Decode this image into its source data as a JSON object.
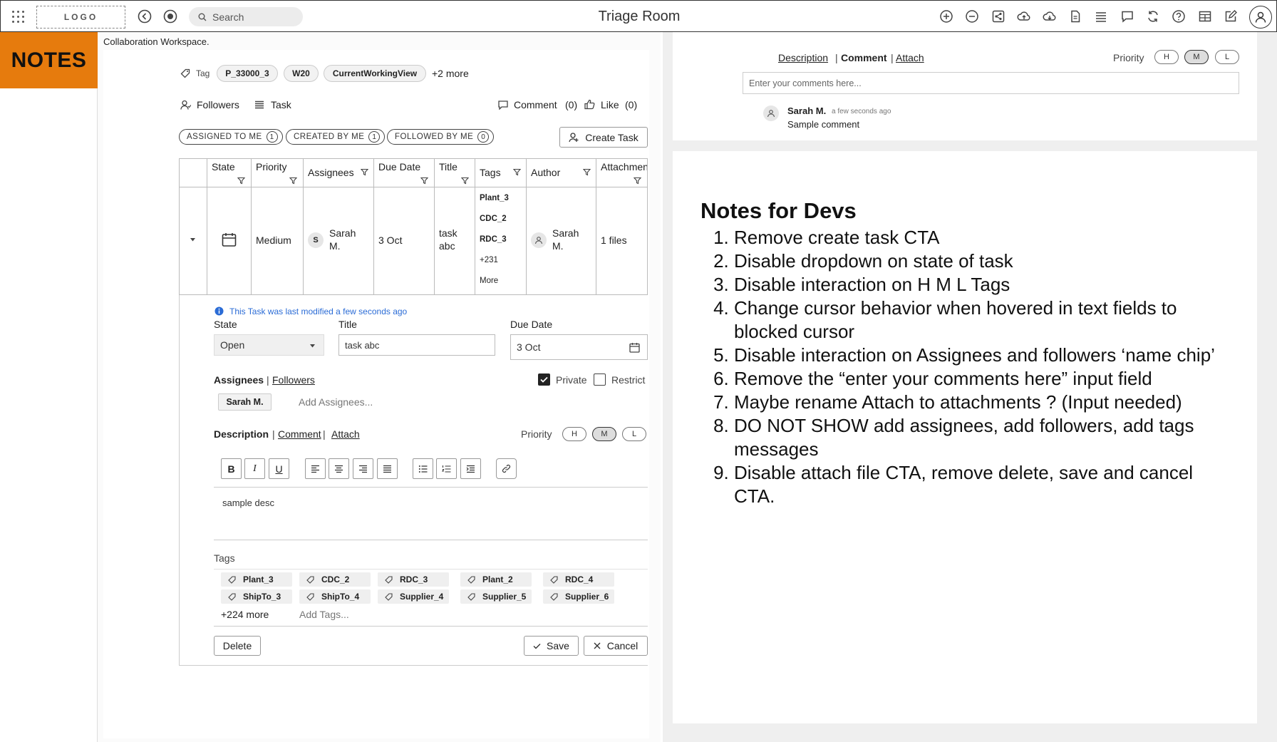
{
  "header": {
    "logo": "LOGO",
    "search_placeholder": "Search",
    "title": "Triage Room"
  },
  "sidebar": {
    "badge": "NOTES"
  },
  "workspace_label": "Collaboration Workspace.",
  "tags_bar": {
    "label": "Tag",
    "chips": [
      "P_33000_3",
      "W20",
      "CurrentWorkingView"
    ],
    "more": "+2 more"
  },
  "social": {
    "followers": "Followers",
    "task": "Task",
    "comment": "Comment",
    "comment_count": "(0)",
    "like": "Like",
    "like_count": "(0)"
  },
  "filters": [
    {
      "label": "ASSIGNED TO ME",
      "count": "1"
    },
    {
      "label": "CREATED BY ME",
      "count": "1"
    },
    {
      "label": "FOLLOWED BY ME",
      "count": "0"
    }
  ],
  "create_task": "Create Task",
  "table": {
    "headers": [
      "State",
      "Priority",
      "Assignees",
      "Due Date",
      "Title",
      "Tags",
      "Author",
      "Attachments"
    ],
    "row": {
      "priority": "Medium",
      "assignee_initial": "S",
      "assignee_first": "Sarah",
      "assignee_last": "M.",
      "due_date": "3 Oct",
      "title_line1": "task",
      "title_line2": "abc",
      "tags": [
        "Plant_3",
        "CDC_2",
        "RDC_3"
      ],
      "tags_more": "+231",
      "tags_more_label": "More",
      "author_first": "Sarah",
      "author_last": "M.",
      "attachments": "1 files"
    }
  },
  "detail": {
    "modified_note": "This Task was last modified a few seconds ago",
    "state_label": "State",
    "state_value": "Open",
    "title_label": "Title",
    "title_value": "task abc",
    "due_label": "Due Date",
    "due_value": "3 Oct",
    "assignees_tab": "Assignees",
    "followers_tab": "Followers",
    "private": "Private",
    "restrict": "Restrict",
    "assignee_chip": "Sarah M.",
    "add_assignees": "Add Assignees...",
    "desc_tab": "Description",
    "comment_tab": "Comment",
    "attach_tab": "Attach",
    "priority_label": "Priority",
    "priority_options": [
      "H",
      "M",
      "L"
    ],
    "description": "sample desc",
    "tags_label": "Tags",
    "tags": [
      "Plant_3",
      "CDC_2",
      "RDC_3",
      "Plant_2",
      "RDC_4",
      "ShipTo_3",
      "ShipTo_4",
      "Supplier_4",
      "Supplier_5",
      "Supplier_6"
    ],
    "tags_more": "+224 more",
    "add_tags": "Add Tags...",
    "delete": "Delete",
    "save": "Save",
    "cancel": "Cancel"
  },
  "comments_panel": {
    "desc_tab": "Description",
    "comment_tab": "Comment",
    "attach_tab": "Attach",
    "priority_label": "Priority",
    "priority_options": [
      "H",
      "M",
      "L"
    ],
    "input_placeholder": "Enter your comments here...",
    "comment_author": "Sarah M.",
    "comment_time": "a few seconds ago",
    "comment_text": "Sample comment"
  },
  "dev_notes": {
    "title": "Notes for Devs",
    "items": [
      "Remove create task CTA",
      "Disable dropdown on state of task",
      "Disable interaction on H M L Tags",
      "Change cursor behavior when hovered in text fields to blocked cursor",
      "Disable interaction on Assignees and followers ‘name chip’",
      "Remove the “enter your comments here” input field",
      "Maybe rename Attach to attachments ? (Input needed)",
      "DO NOT SHOW add assignees, add followers, add tags messages",
      "Disable attach file CTA, remove delete, save and cancel CTA."
    ]
  }
}
